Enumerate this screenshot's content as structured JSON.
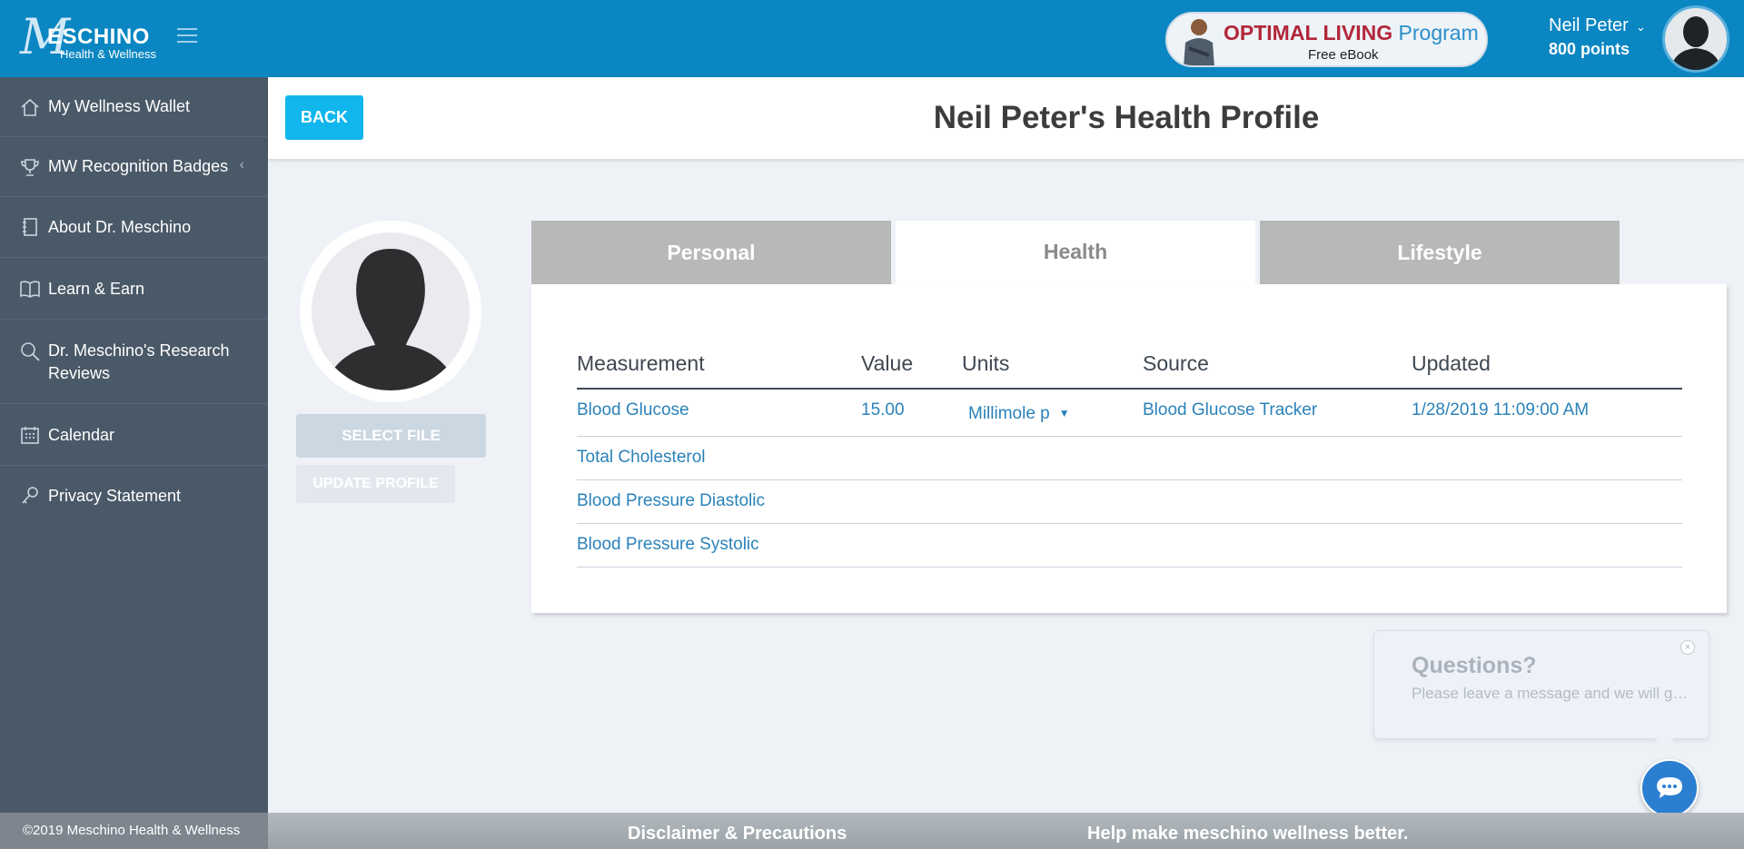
{
  "brand": {
    "logo_mark": "M",
    "logo_name": "ESCHINO",
    "logo_sub": "Health & Wellness"
  },
  "promo": {
    "title_red": "OPTIMAL LIVING",
    "title_blue": "Program",
    "subtitle": "Free eBook"
  },
  "user": {
    "name": "Neil Peter",
    "points": "800 points"
  },
  "sidebar": {
    "items": [
      {
        "label": "My Wellness Wallet",
        "icon": "home-icon"
      },
      {
        "label": "MW Recognition Badges",
        "icon": "trophy-icon"
      },
      {
        "label": "About Dr. Meschino",
        "icon": "notebook-icon"
      },
      {
        "label": "Learn & Earn",
        "icon": "book-icon"
      },
      {
        "label": "Dr. Meschino's Research Reviews",
        "icon": "search-icon"
      },
      {
        "label": "Calendar",
        "icon": "calendar-icon"
      },
      {
        "label": "Privacy Statement",
        "icon": "key-icon"
      }
    ]
  },
  "header": {
    "back_label": "BACK",
    "title": "Neil Peter's Health Profile"
  },
  "profile": {
    "select_file_label": "SELECT FILE",
    "update_profile_label": "UPDATE PROFILE"
  },
  "tabs": [
    {
      "label": "Personal",
      "active": false
    },
    {
      "label": "Health",
      "active": true
    },
    {
      "label": "Lifestyle",
      "active": false
    }
  ],
  "table": {
    "columns": [
      "Measurement",
      "Value",
      "Units",
      "Source",
      "Updated"
    ],
    "rows": [
      {
        "measurement": "Blood Glucose",
        "value": "15.00",
        "units": "Millimole p",
        "source": "Blood Glucose Tracker",
        "updated": "1/28/2019 11:09:00 AM"
      },
      {
        "measurement": "Total Cholesterol",
        "value": "",
        "units": "",
        "source": "",
        "updated": ""
      },
      {
        "measurement": "Blood Pressure Diastolic",
        "value": "",
        "units": "",
        "source": "",
        "updated": ""
      },
      {
        "measurement": "Blood Pressure Systolic",
        "value": "",
        "units": "",
        "source": "",
        "updated": ""
      }
    ]
  },
  "chat": {
    "title": "Questions?",
    "message": "Please leave a message and we will get back to you.",
    "close_symbol": "×"
  },
  "footer": {
    "copyright": "©2019 Meschino Health & Wellness",
    "disclaimer": "Disclaimer & Precautions",
    "feedback": "Help make meschino wellness better."
  },
  "colors": {
    "topbar": "#0a86c2",
    "sidebar": "#4a5968",
    "accent": "#10b6ec",
    "link": "#2a82b9",
    "tab_inactive": "#b8b8b8"
  }
}
